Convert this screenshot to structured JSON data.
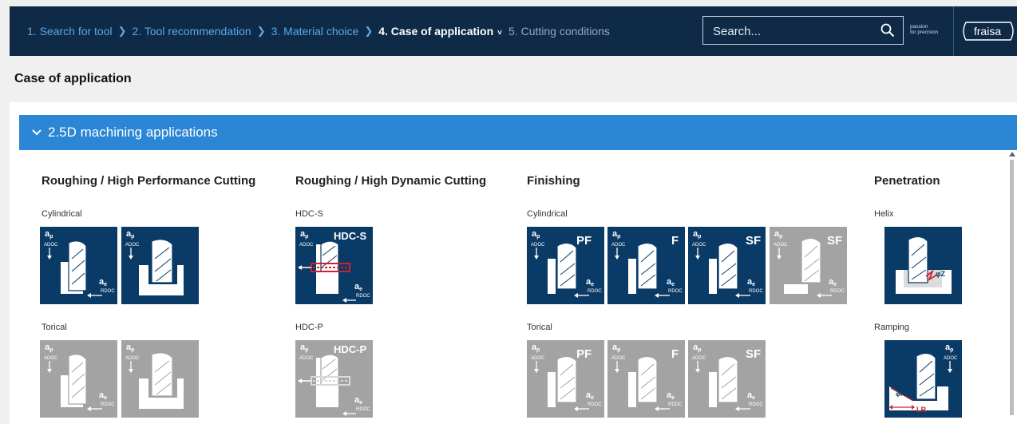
{
  "breadcrumb": {
    "steps": [
      "1. Search for tool",
      "2. Tool recommendation",
      "3. Material choice",
      "4. Case of application",
      "5. Cutting conditions"
    ]
  },
  "search": {
    "placeholder": "Search..."
  },
  "brand": {
    "tagline_1": "passion",
    "tagline_2": "for precision",
    "logo_text": "fraisa"
  },
  "page": {
    "title": "Case of application"
  },
  "section": {
    "title": "2.5D machining applications"
  },
  "columns": {
    "hpc": {
      "title": "Roughing / High Performance Cutting",
      "sub1": "Cylindrical",
      "sub2": "Torical"
    },
    "hdc": {
      "title": "Roughing / High Dynamic Cutting",
      "sub1": "HDC-S",
      "sub2": "HDC-P"
    },
    "fin": {
      "title": "Finishing",
      "sub1": "Cylindrical",
      "sub2": "Torical"
    },
    "pen": {
      "title": "Penetration",
      "sub1": "Helix",
      "sub2": "Ramping"
    }
  },
  "tile_labels": {
    "ap": "a",
    "ap_sub": "p",
    "adoc": "ADOC",
    "ae": "a",
    "ae_sub": "e",
    "rdoc": "RDOC",
    "hdc_s": "HDC-S",
    "hdc_p": "HDC-P",
    "pf": "PF",
    "f": "F",
    "sf": "SF",
    "phi_z": "φZ",
    "phi_r": "φR",
    "lr": "LR"
  },
  "colors": {
    "navy": "#0e2a47",
    "blue": "#2b86d6",
    "tile_active": "#0a3a66",
    "tile_inactive": "#a3a3a3"
  }
}
